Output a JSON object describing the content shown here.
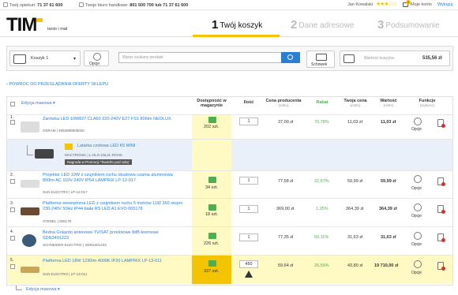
{
  "topbar": {
    "contact_label": "Twój opiekun:",
    "contact_phone": "71 37 61 600",
    "office_label": "Twoje biuro handlowe:",
    "office_phone": "801 500 700 lub 71 37 61 600",
    "user": "Jan Kowalski",
    "cart_count": "2",
    "account": "Moje konto",
    "logout": "Wyloguj"
  },
  "header": {
    "logo": "TIM",
    "tagline": "tanio i mał",
    "steps": [
      {
        "n": "1",
        "label": "Twój koszyk"
      },
      {
        "n": "2",
        "label": "Dane adresowe"
      },
      {
        "n": "3",
        "label": "Podsumowanie"
      }
    ]
  },
  "toolbar": {
    "cart_name": "Koszyk 1",
    "options": "Opcje",
    "search_placeholder": "Wpisz szukany produkt",
    "saved": "Schowek",
    "value_label": "Wartość koszyka:",
    "value": "535,56 zł"
  },
  "back_link": "POWRÓC DO PRZEGLĄDANIA OFERTY SKLEPU",
  "table": {
    "mass_edit": "Edycja masowa",
    "headers": {
      "availability": "Dostępność w magazynie",
      "qty": "Ilość",
      "producer_price": "Cena producenta",
      "producer_price_sub": "(netto)",
      "discount": "Rabat",
      "your_price": "Twoja cena",
      "your_price_sub": "(netto)",
      "value": "Wartość",
      "value_sub": "(netto)",
      "functions": "Funkcje",
      "functions_sub": "(wybierz)"
    },
    "rows": [
      {
        "idx": "1.",
        "name": "Żarówka LED 10W827 CLA60 220-240V E27 FS1 806lm NEOLUX",
        "sub": "OSRAM | 4052899905020",
        "stock": "202 szt.",
        "qty": "1",
        "pprice": "37,00 zł",
        "disc": "70,78%",
        "price": "11,03 zł",
        "value": "11,03 zł",
        "opt": "Opcje"
      },
      {
        "name": "Latarka czołowa LED K5 MINI",
        "sub": "MACTRONIC | L-HLS-1NL2L-ROHS",
        "badge": "Nagroda w Promocji \"Świeżło pod ręką\""
      },
      {
        "idx": "2.",
        "name": "Projektor LED 10W z czujnikiem ruchu obudowa czarna aluminiowa 800lm AC 110V-240V IP54 LAMPRIX LP-12-017",
        "sub": "SUN ELECTRO | LP-12-017",
        "stock": "34 szt.",
        "qty": "1",
        "pprice": "77,58 zł",
        "disc": "22,67%",
        "price": "59,99 zł",
        "value": "59,99 zł",
        "opt": "Opcje"
      },
      {
        "idx": "3.",
        "name": "Platforma wewnętrzna LED z czujnikiem ruchu 5 metrów 11W 360 stopni 230-240V 50Hz IP44 biała RS LED A1 EVO 005178",
        "sub": "STENEL | 005178",
        "stock": "18 szt.",
        "qty": "1",
        "pprice": "369,00 zł",
        "disc": "1,25%",
        "price": "364,39 zł",
        "value": "364,39 zł",
        "opt": "Opcje"
      },
      {
        "idx": "4.",
        "name": "Bedna Gniazdo antenowe TV/SAT przelotowe 8dB kremowe SDN3401223",
        "sub": "SCHNEIDER ELECTRIC | SDN3401223",
        "stock": "226 szt.",
        "qty": "1",
        "pprice": "77,35 zł",
        "disc": "59,11%",
        "price": "31,63 zł",
        "value": "31,63 zł",
        "opt": "Opcje"
      },
      {
        "idx": "5.",
        "name": "Platforma LED 18W 1230lm 4000K IP20 LAMPRIX LP-13-011",
        "sub": "SUN ELECTRO | LP-13-011",
        "stock": "337 szt.",
        "qty": "450",
        "pprice": "59,64 zł",
        "disc": "26,56%",
        "price": "43,80 zł",
        "value": "19 710,00 zł",
        "opt": "Opcje"
      }
    ]
  },
  "footer_mass_edit": "Edycja masowa",
  "colors": {
    "accent": "#f5c400",
    "link": "#2a7fd4",
    "discount": "#4caf50"
  }
}
